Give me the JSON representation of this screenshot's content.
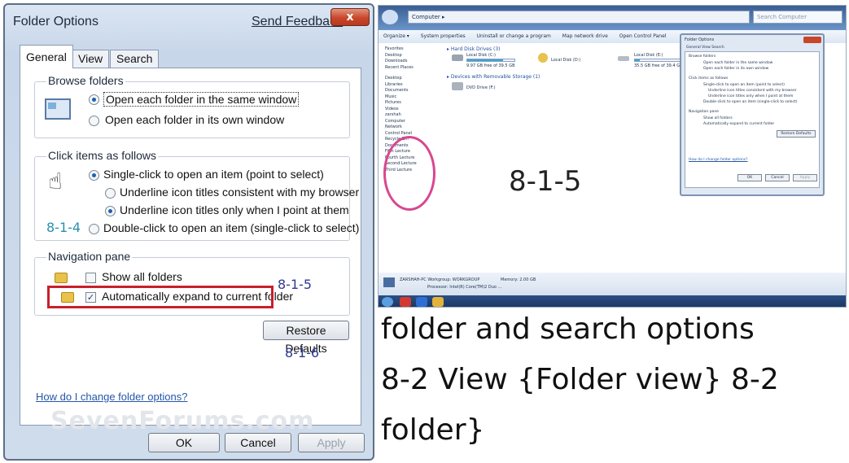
{
  "dialog": {
    "title": "Folder Options",
    "feedback_link": "Send Feedback",
    "close_glyph": "x",
    "tabs": [
      "General",
      "View",
      "Search"
    ],
    "browse": {
      "title": "Browse folders",
      "opt_same": "Open each folder in the same window",
      "opt_own": "Open each folder in its own window"
    },
    "click": {
      "title": "Click items as follows",
      "opt_single": "Single-click to open an item (point to select)",
      "opt_underline_consistent": "Underline icon titles consistent with my browser",
      "opt_underline_point": "Underline icon titles only when I point at them",
      "opt_double": "Double-click to open an item (single-click to select)"
    },
    "nav": {
      "title": "Navigation pane",
      "show_all": "Show all folders",
      "auto_expand": "Automatically expand to current folder"
    },
    "restore_button": "Restore Defaults",
    "help_link": "How do I change folder options?",
    "watermark": "SevenForums.com",
    "ok_button": "OK",
    "cancel_button": "Cancel",
    "apply_button": "Apply",
    "annotations": {
      "a814": "8-1-4",
      "a815": "8-1-5",
      "a816": "8-1-6"
    }
  },
  "explorer": {
    "address": "Computer ▸",
    "search_placeholder": "Search Computer",
    "commands": [
      "Organize ▾",
      "System properties",
      "Uninstall or change a program",
      "Map network drive",
      "Open Control Panel"
    ],
    "sidebar": [
      "Favorites",
      "Desktop",
      "Downloads",
      "Recent Places",
      "",
      "Desktop",
      "Libraries",
      "Documents",
      "Music",
      "Pictures",
      "Videos",
      "zarshah",
      "Computer",
      "Network",
      "Control Panel",
      "Recycle Bin",
      "Documents",
      "Fifth Lecture",
      "Fourth Lecture",
      "Second Lecture",
      "Third Lecture"
    ],
    "hdd_header": "▸ Hard Disk Drives (3)",
    "drive_c": "Local Disk (C:)",
    "drive_c_free": "9.97 GB free of 39.5 GB",
    "drive_d": "Local Disk (D:)",
    "drive_e": "Local Disk (E:)",
    "drive_e_free": "35.5 GB free of 39.4 GB",
    "removable_header": "▸ Devices with Removable Storage (1)",
    "dvd": "DVD Drive (F:)",
    "big_label": "8-1-5",
    "mini": {
      "title": "Folder Options",
      "tabs": "General  View  Search",
      "browse": "Browse folders",
      "same": "Open each folder in the same window",
      "own": "Open each folder in its own window",
      "click": "Click items as follows",
      "single": "Single-click to open an item (point to select)",
      "u1": "Underline icon titles consistent with my browser",
      "u2": "Underline icon titles only when I point at them",
      "dbl": "Double-click to open an item (single-click to select)",
      "nav": "Navigation pane",
      "show": "Show all folders",
      "auto": "Automatically expand to current folder",
      "restore": "Restore Defaults",
      "help": "How do I change folder options?",
      "ok": "OK",
      "cancel": "Cancel",
      "apply": "Apply"
    },
    "status_pc": "ZARSHAH-PC  Workgroup: WORKGROUP",
    "status_mem": "Memory: 2.00 GB",
    "status_cpu": "Processor: Intel(R) Core(TM)2 Duo ..."
  },
  "caption": {
    "line1": "folder and search options",
    "line2": "8-2 View {Folder view} 8-2",
    "line3": "folder}"
  }
}
